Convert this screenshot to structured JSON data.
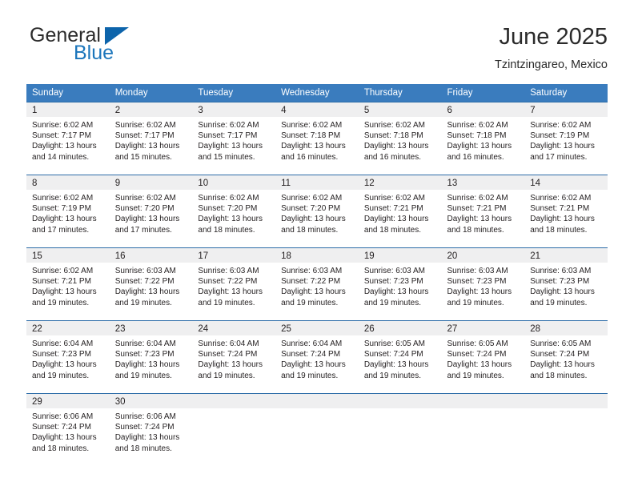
{
  "brand": {
    "name_top": "General",
    "name_bottom": "Blue",
    "triangle_icon": "triangle-logo-icon",
    "color_top": "#2b2b2b",
    "color_bottom": "#1b75bb",
    "color_triangle": "#0d64ab"
  },
  "header": {
    "title": "June 2025",
    "subtitle": "Tzintzingareo, Mexico"
  },
  "theme": {
    "header_bg": "#3a7cbe",
    "header_text": "#ffffff",
    "row_border": "#2c6ca8",
    "daynum_bg": "#efeff0",
    "cell_bg": "#ffffff",
    "text": "#231f20"
  },
  "columns": [
    "Sunday",
    "Monday",
    "Tuesday",
    "Wednesday",
    "Thursday",
    "Friday",
    "Saturday"
  ],
  "weeks": [
    [
      {
        "day": "1",
        "sunrise": "Sunrise: 6:02 AM",
        "sunset": "Sunset: 7:17 PM",
        "daylight1": "Daylight: 13 hours",
        "daylight2": "and 14 minutes."
      },
      {
        "day": "2",
        "sunrise": "Sunrise: 6:02 AM",
        "sunset": "Sunset: 7:17 PM",
        "daylight1": "Daylight: 13 hours",
        "daylight2": "and 15 minutes."
      },
      {
        "day": "3",
        "sunrise": "Sunrise: 6:02 AM",
        "sunset": "Sunset: 7:17 PM",
        "daylight1": "Daylight: 13 hours",
        "daylight2": "and 15 minutes."
      },
      {
        "day": "4",
        "sunrise": "Sunrise: 6:02 AM",
        "sunset": "Sunset: 7:18 PM",
        "daylight1": "Daylight: 13 hours",
        "daylight2": "and 16 minutes."
      },
      {
        "day": "5",
        "sunrise": "Sunrise: 6:02 AM",
        "sunset": "Sunset: 7:18 PM",
        "daylight1": "Daylight: 13 hours",
        "daylight2": "and 16 minutes."
      },
      {
        "day": "6",
        "sunrise": "Sunrise: 6:02 AM",
        "sunset": "Sunset: 7:18 PM",
        "daylight1": "Daylight: 13 hours",
        "daylight2": "and 16 minutes."
      },
      {
        "day": "7",
        "sunrise": "Sunrise: 6:02 AM",
        "sunset": "Sunset: 7:19 PM",
        "daylight1": "Daylight: 13 hours",
        "daylight2": "and 17 minutes."
      }
    ],
    [
      {
        "day": "8",
        "sunrise": "Sunrise: 6:02 AM",
        "sunset": "Sunset: 7:19 PM",
        "daylight1": "Daylight: 13 hours",
        "daylight2": "and 17 minutes."
      },
      {
        "day": "9",
        "sunrise": "Sunrise: 6:02 AM",
        "sunset": "Sunset: 7:20 PM",
        "daylight1": "Daylight: 13 hours",
        "daylight2": "and 17 minutes."
      },
      {
        "day": "10",
        "sunrise": "Sunrise: 6:02 AM",
        "sunset": "Sunset: 7:20 PM",
        "daylight1": "Daylight: 13 hours",
        "daylight2": "and 18 minutes."
      },
      {
        "day": "11",
        "sunrise": "Sunrise: 6:02 AM",
        "sunset": "Sunset: 7:20 PM",
        "daylight1": "Daylight: 13 hours",
        "daylight2": "and 18 minutes."
      },
      {
        "day": "12",
        "sunrise": "Sunrise: 6:02 AM",
        "sunset": "Sunset: 7:21 PM",
        "daylight1": "Daylight: 13 hours",
        "daylight2": "and 18 minutes."
      },
      {
        "day": "13",
        "sunrise": "Sunrise: 6:02 AM",
        "sunset": "Sunset: 7:21 PM",
        "daylight1": "Daylight: 13 hours",
        "daylight2": "and 18 minutes."
      },
      {
        "day": "14",
        "sunrise": "Sunrise: 6:02 AM",
        "sunset": "Sunset: 7:21 PM",
        "daylight1": "Daylight: 13 hours",
        "daylight2": "and 18 minutes."
      }
    ],
    [
      {
        "day": "15",
        "sunrise": "Sunrise: 6:02 AM",
        "sunset": "Sunset: 7:21 PM",
        "daylight1": "Daylight: 13 hours",
        "daylight2": "and 19 minutes."
      },
      {
        "day": "16",
        "sunrise": "Sunrise: 6:03 AM",
        "sunset": "Sunset: 7:22 PM",
        "daylight1": "Daylight: 13 hours",
        "daylight2": "and 19 minutes."
      },
      {
        "day": "17",
        "sunrise": "Sunrise: 6:03 AM",
        "sunset": "Sunset: 7:22 PM",
        "daylight1": "Daylight: 13 hours",
        "daylight2": "and 19 minutes."
      },
      {
        "day": "18",
        "sunrise": "Sunrise: 6:03 AM",
        "sunset": "Sunset: 7:22 PM",
        "daylight1": "Daylight: 13 hours",
        "daylight2": "and 19 minutes."
      },
      {
        "day": "19",
        "sunrise": "Sunrise: 6:03 AM",
        "sunset": "Sunset: 7:23 PM",
        "daylight1": "Daylight: 13 hours",
        "daylight2": "and 19 minutes."
      },
      {
        "day": "20",
        "sunrise": "Sunrise: 6:03 AM",
        "sunset": "Sunset: 7:23 PM",
        "daylight1": "Daylight: 13 hours",
        "daylight2": "and 19 minutes."
      },
      {
        "day": "21",
        "sunrise": "Sunrise: 6:03 AM",
        "sunset": "Sunset: 7:23 PM",
        "daylight1": "Daylight: 13 hours",
        "daylight2": "and 19 minutes."
      }
    ],
    [
      {
        "day": "22",
        "sunrise": "Sunrise: 6:04 AM",
        "sunset": "Sunset: 7:23 PM",
        "daylight1": "Daylight: 13 hours",
        "daylight2": "and 19 minutes."
      },
      {
        "day": "23",
        "sunrise": "Sunrise: 6:04 AM",
        "sunset": "Sunset: 7:23 PM",
        "daylight1": "Daylight: 13 hours",
        "daylight2": "and 19 minutes."
      },
      {
        "day": "24",
        "sunrise": "Sunrise: 6:04 AM",
        "sunset": "Sunset: 7:24 PM",
        "daylight1": "Daylight: 13 hours",
        "daylight2": "and 19 minutes."
      },
      {
        "day": "25",
        "sunrise": "Sunrise: 6:04 AM",
        "sunset": "Sunset: 7:24 PM",
        "daylight1": "Daylight: 13 hours",
        "daylight2": "and 19 minutes."
      },
      {
        "day": "26",
        "sunrise": "Sunrise: 6:05 AM",
        "sunset": "Sunset: 7:24 PM",
        "daylight1": "Daylight: 13 hours",
        "daylight2": "and 19 minutes."
      },
      {
        "day": "27",
        "sunrise": "Sunrise: 6:05 AM",
        "sunset": "Sunset: 7:24 PM",
        "daylight1": "Daylight: 13 hours",
        "daylight2": "and 19 minutes."
      },
      {
        "day": "28",
        "sunrise": "Sunrise: 6:05 AM",
        "sunset": "Sunset: 7:24 PM",
        "daylight1": "Daylight: 13 hours",
        "daylight2": "and 18 minutes."
      }
    ],
    [
      {
        "day": "29",
        "sunrise": "Sunrise: 6:06 AM",
        "sunset": "Sunset: 7:24 PM",
        "daylight1": "Daylight: 13 hours",
        "daylight2": "and 18 minutes."
      },
      {
        "day": "30",
        "sunrise": "Sunrise: 6:06 AM",
        "sunset": "Sunset: 7:24 PM",
        "daylight1": "Daylight: 13 hours",
        "daylight2": "and 18 minutes."
      },
      {
        "day": "",
        "sunrise": "",
        "sunset": "",
        "daylight1": "",
        "daylight2": ""
      },
      {
        "day": "",
        "sunrise": "",
        "sunset": "",
        "daylight1": "",
        "daylight2": ""
      },
      {
        "day": "",
        "sunrise": "",
        "sunset": "",
        "daylight1": "",
        "daylight2": ""
      },
      {
        "day": "",
        "sunrise": "",
        "sunset": "",
        "daylight1": "",
        "daylight2": ""
      },
      {
        "day": "",
        "sunrise": "",
        "sunset": "",
        "daylight1": "",
        "daylight2": ""
      }
    ]
  ]
}
